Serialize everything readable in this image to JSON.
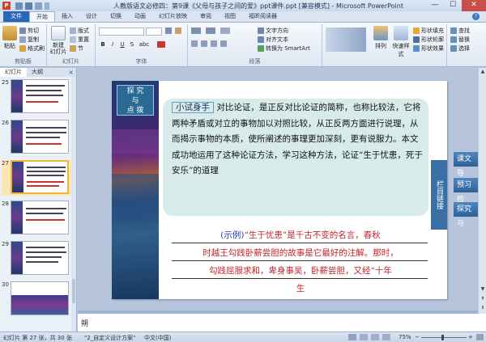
{
  "titlebar": {
    "app_icon": "P",
    "title": "人教版语文必修四：第9课《父母与孩子之间的爱》ppt课件.ppt [兼容模式] - Microsoft PowerPoint",
    "minimize": "—",
    "maximize": "☐",
    "close": "✕"
  },
  "tabs": [
    "文件",
    "开始",
    "插入",
    "设计",
    "切换",
    "动画",
    "幻灯片放映",
    "审阅",
    "视图",
    "福昕阅读器"
  ],
  "ribbon": {
    "clipboard": {
      "paste": "粘贴",
      "cut": "剪切",
      "copy": "复制",
      "format_painter": "格式刷",
      "label": "剪贴板"
    },
    "slides": {
      "new_slide": "新建\n幻灯片",
      "layout": "版式",
      "reset": "重置",
      "section": "节",
      "label": "幻灯片"
    },
    "font": {
      "label": "字体",
      "bold": "B",
      "italic": "I",
      "underline": "U",
      "strike": "S",
      "shadow": "abc"
    },
    "paragraph": {
      "label": "段落",
      "text_direction": "文字方向",
      "align_text": "对齐文本",
      "smartart": "转换为 SmartArt"
    },
    "drawing": {
      "arrange": "排列",
      "quick_styles": "快速样式",
      "fill": "形状填充",
      "outline": "形状轮廓",
      "effects": "形状效果"
    },
    "editing": {
      "find": "查找",
      "replace": "替换",
      "select": "选择"
    }
  },
  "panel": {
    "tabs": [
      "幻灯片",
      "大纲"
    ],
    "close": "×",
    "thumbs": [
      {
        "num": "25",
        "sel": false
      },
      {
        "num": "26",
        "sel": false
      },
      {
        "num": "27",
        "sel": true
      },
      {
        "num": "28",
        "sel": false
      },
      {
        "num": "29",
        "sel": false
      },
      {
        "num": "30",
        "sel": false
      }
    ]
  },
  "slide": {
    "badge": "探 究\n与\n点 拨",
    "tag": "小试身手",
    "body": "对比论证，是正反对比论证的简称，也称比较法，它将两种矛盾或对立的事物加以对照比较，从正反两方面进行说理，从而揭示事物的本质，使所阐述的事理更加深刻，更有说服力。本文成功地运用了这种论证方法，学习这种方法，论证“生于忧患，死于安乐”的道理",
    "example_label": "(示例)",
    "example_line1": "“生于忧患”是千古不变的名言，春秋",
    "example_line2": "时越王勾践卧薪尝胆的故事是它最好的注解。那时，",
    "example_line3": "勾践屈服求和，卑身事吴，卧薪尝胆，又经“十年",
    "example_line4": "生",
    "side_tab": "栏目链接"
  },
  "callouts": [
    "课文导",
    "预习检",
    "探究与"
  ],
  "notes": {
    "text": "朔"
  },
  "status": {
    "slide_info": "幻灯片 第 27 张，共 30 张",
    "theme": "\"2_自定义设计方案\"",
    "lang": "中文(中国)",
    "zoom": "75%"
  },
  "colors": {
    "accent": "#2a66b8",
    "slide_box": "#d7ecea",
    "red_text": "#c0262a",
    "blue_text": "#1e35b0"
  }
}
